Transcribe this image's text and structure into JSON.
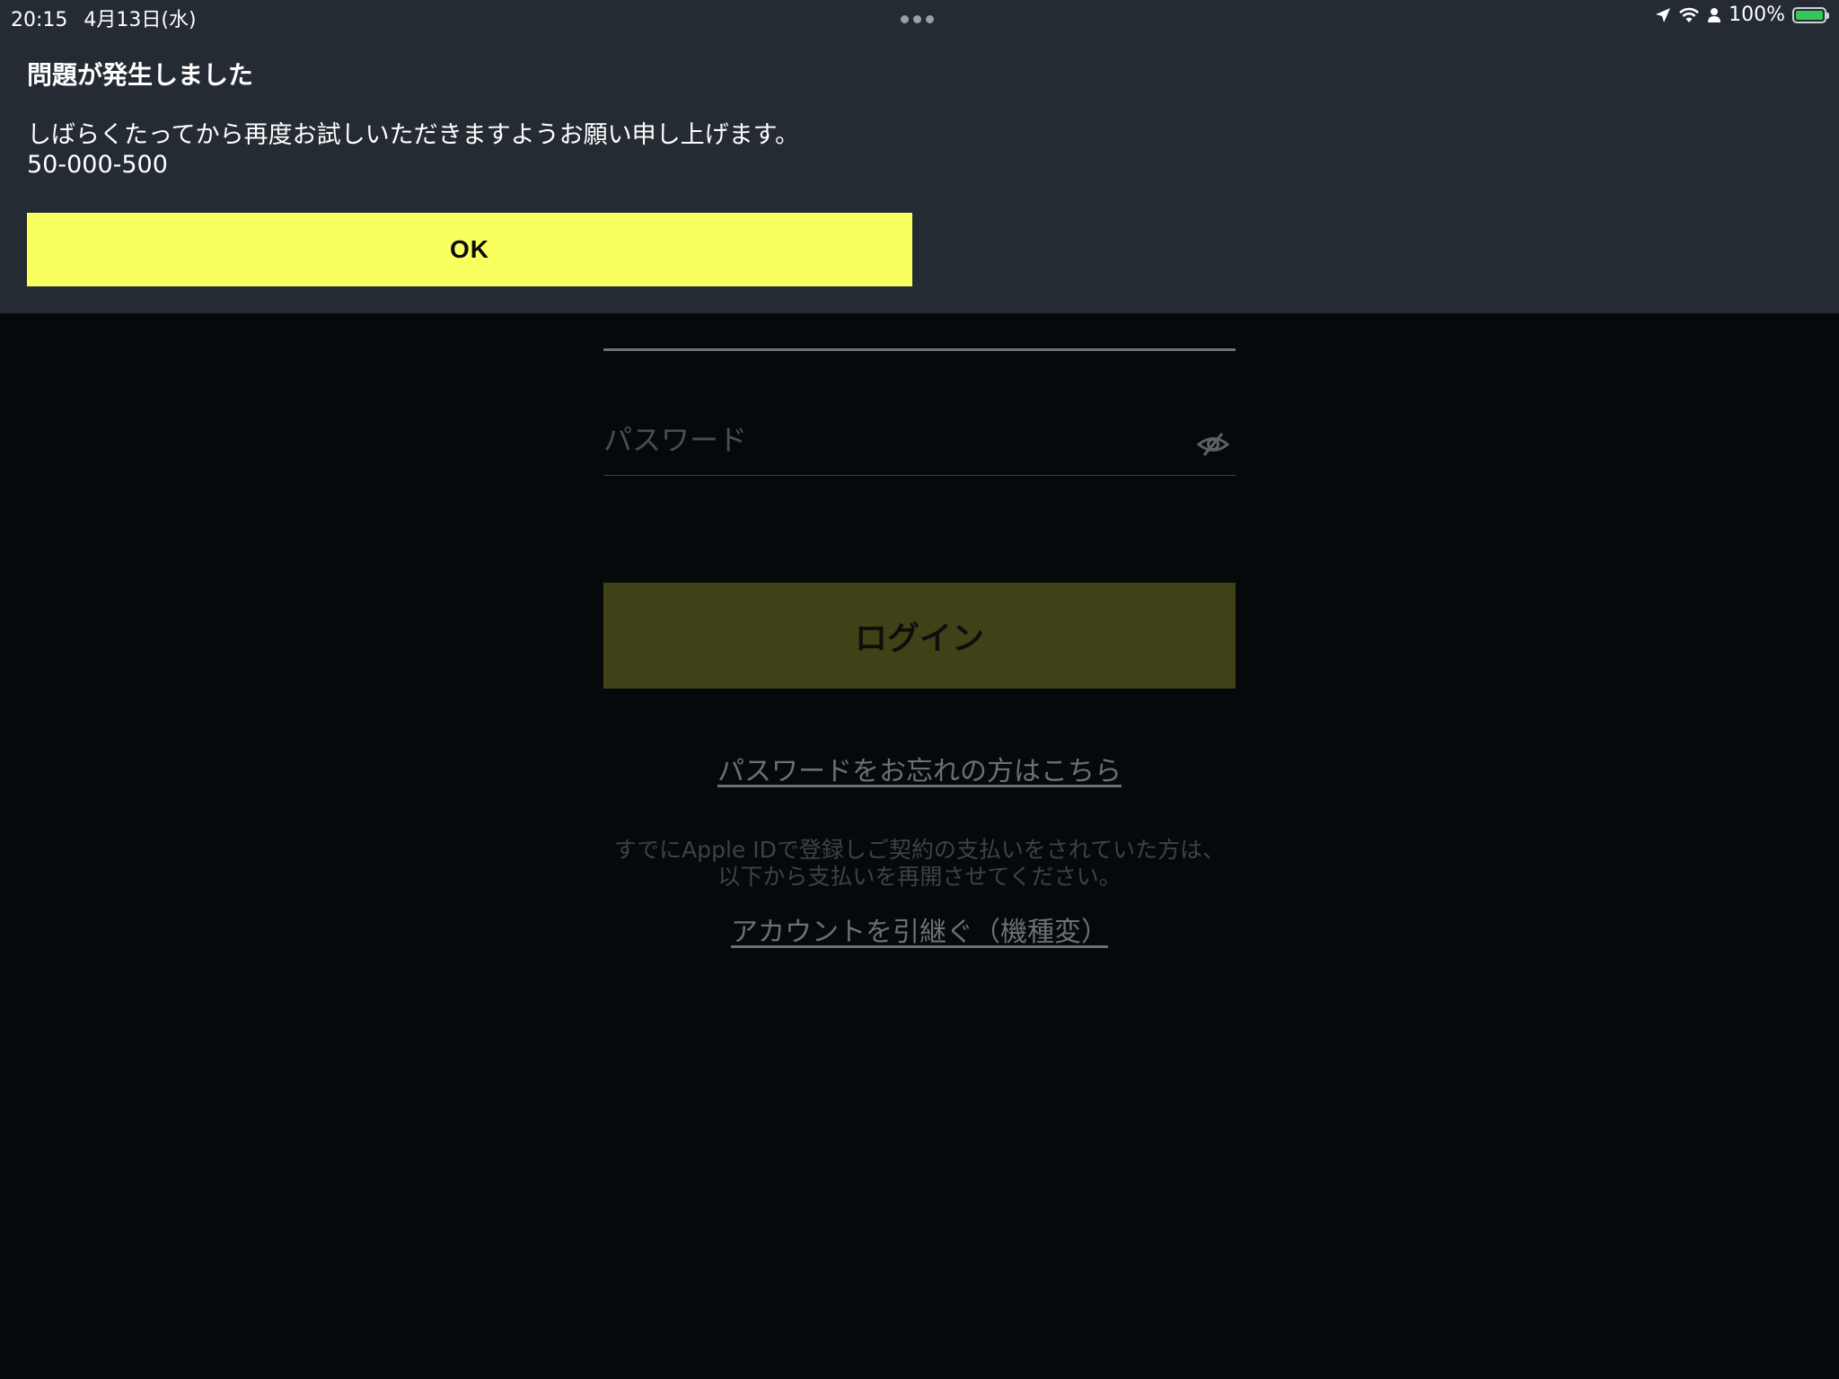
{
  "status_bar": {
    "time": "20:15",
    "date": "4月13日(水)",
    "battery": "100%",
    "battery_level": 1.0
  },
  "alert": {
    "title": "問題が発生しました",
    "message": "しばらくたってから再度お試しいただきますようお願い申し上げます。",
    "code": "50-000-500",
    "ok_label": "OK",
    "ok_color": "#f8ff5e",
    "background": "#252b33"
  },
  "login": {
    "password_placeholder": "パスワード",
    "password_value": "",
    "login_label": "ログイン",
    "login_color": "#414118",
    "forgot_password": "パスワードをお忘れの方はこちら",
    "apple_note_line1": "すでにApple IDで登録しご契約の支払いをされていた方は、",
    "apple_note_line2": "以下から支払いを再開させてください。",
    "transfer_account": "アカウントを引継ぐ（機種変）"
  },
  "icons": {
    "eye": "eye-slash-icon",
    "location": "location-arrow-icon",
    "wifi": "wifi-icon",
    "person": "person-icon",
    "battery": "battery-charging-icon"
  }
}
